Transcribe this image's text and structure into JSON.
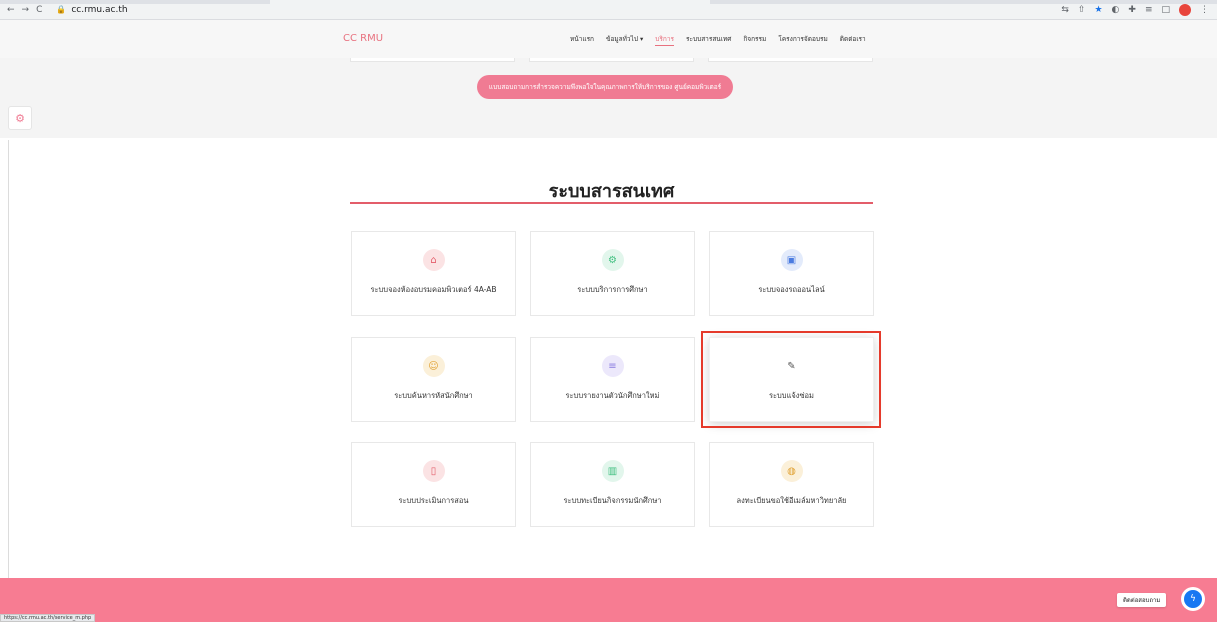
{
  "browser": {
    "url": "cc.rmu.ac.th",
    "status_url": "https://cc.rmu.ac.th/service_m.php",
    "back_icon": "arrow-left-icon",
    "forward_icon": "arrow-right-icon",
    "reload_icon": "reload-icon"
  },
  "header": {
    "brand": "CC RMU",
    "menu": [
      {
        "label": "หน้าแรก"
      },
      {
        "label": "ข้อมูลทั่วไป ▾"
      },
      {
        "label": "บริการ"
      },
      {
        "label": "ระบบสารสนเทศ"
      },
      {
        "label": "กิจกรรม"
      },
      {
        "label": "โครงการจัดอบรม"
      },
      {
        "label": "ติดต่อเรา"
      }
    ],
    "active_menu": "บริการ"
  },
  "survey": {
    "button_label": "แบบสอบถามการสำรวจความพึงพอใจในคุณภาพการให้บริการของ ศูนย์คอมพิวเตอร์"
  },
  "section": {
    "title": "ระบบสารสนเทศ",
    "cards": [
      {
        "label": "ระบบจองห้องอบรมคอมพิวเตอร์ 4A-AB",
        "icon": "home-icon",
        "color": "#e35d6a",
        "bg": "#fbe3e4"
      },
      {
        "label": "ระบบบริการการศึกษา",
        "icon": "settings-icon",
        "color": "#3fbf7f",
        "bg": "#e2f6ec"
      },
      {
        "label": "ระบบจองรถออนไลน์",
        "icon": "bus-icon",
        "color": "#4a7be0",
        "bg": "#e3ebfb"
      },
      {
        "label": "ระบบค้นหารหัสนักศึกษา",
        "icon": "user-icon",
        "color": "#e0a030",
        "bg": "#fbf0d9"
      },
      {
        "label": "ระบบรายงานตัวนักศึกษาใหม่",
        "icon": "list-icon",
        "color": "#8a7be0",
        "bg": "#ece8fb"
      },
      {
        "label": "ระบบแจ้งซ่อม",
        "icon": "edit-icon",
        "color": "#555555",
        "bg": "#ffffff"
      },
      {
        "label": "ระบบประเมินการสอน",
        "icon": "phone-icon",
        "color": "#e35d6a",
        "bg": "#fbe3e4"
      },
      {
        "label": "ระบบทะเบียนกิจกรรมนักศึกษา",
        "icon": "bar-chart-icon",
        "color": "#3fbf7f",
        "bg": "#e2f6ec"
      },
      {
        "label": "ลงทะเบียนขอใช้อีเมล์มหาวิทยาลัย",
        "icon": "globe-icon",
        "color": "#e0a030",
        "bg": "#fbf0d9"
      }
    ]
  },
  "chat": {
    "label": "ติดต่อสอบถาม",
    "icon": "messenger-icon"
  }
}
